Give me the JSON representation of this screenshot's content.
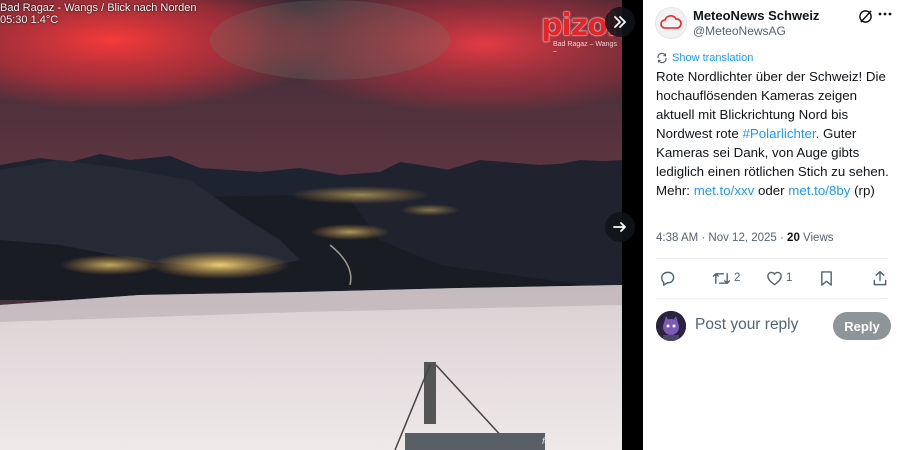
{
  "media": {
    "caption_line1": "Bad Ragaz - Wangs / Blick nach Norden",
    "caption_line2": "05:30    1.4°C",
    "logo_text": "pizol",
    "logo_subtext": "Bad Ragaz – Wangs –",
    "watermark": "foto-webcam.eu",
    "collapse_icon": "double-chevron-right-icon",
    "next_icon": "arrow-right-icon"
  },
  "tweet": {
    "display_name": "MeteoNews Schweiz",
    "handle": "@MeteoNewsAG",
    "show_translation": "Show translation",
    "text": {
      "part1": "Rote Nordlichter über der Schweiz! Die hochauflösenden Kameras zeigen aktuell mit Blickrichtung Nord bis Nordwest rote ",
      "hashtag": "#Polarlichter",
      "part2": ". Guter Kameras sei Dank, von Auge gibts lediglich einen rötlichen Stich zu sehen. Mehr: ",
      "link1": "met.to/xxv",
      "part3": " oder ",
      "link2": "met.to/8by",
      "part4": " (rp)"
    },
    "timestamp": "4:38 AM · Nov 12, 2025 · ",
    "views_count": "20",
    "views_label": " Views",
    "actions": {
      "reply_count": "",
      "retweet_count": "2",
      "like_count": "1"
    },
    "reply_placeholder": "Post your reply",
    "reply_button": "Reply"
  },
  "colors": {
    "accent": "#1d9bf0",
    "text_primary": "#0f1419",
    "text_secondary": "#536471",
    "reply_button_bg": "#8e9599",
    "logo_red": "#e3262a"
  }
}
